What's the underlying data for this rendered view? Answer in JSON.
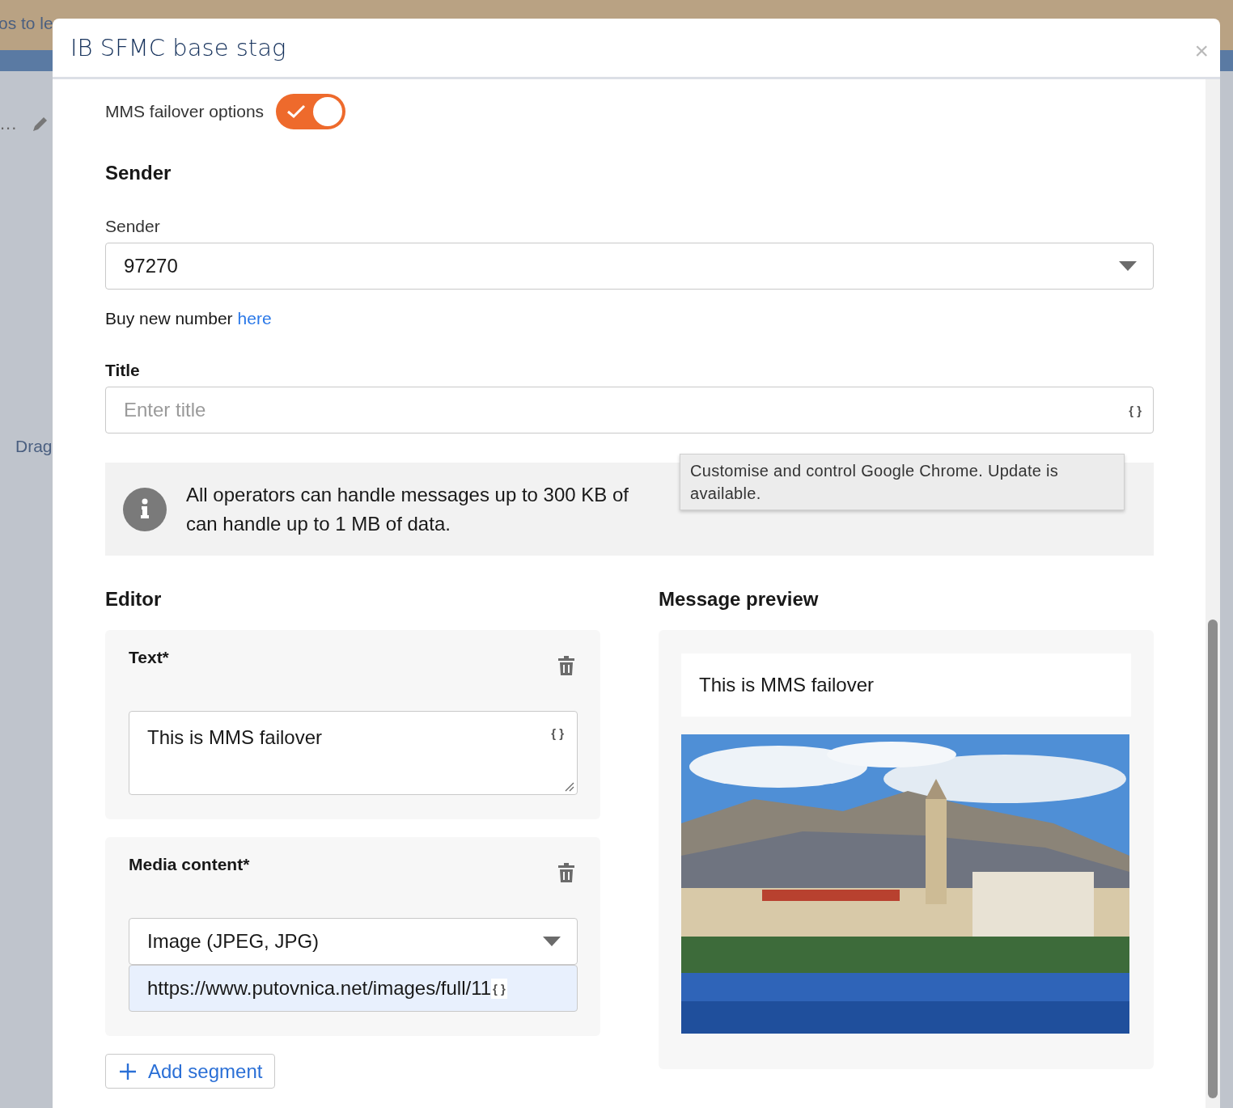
{
  "background": {
    "banner_text": "os to le",
    "side_text": "Drag",
    "menu_text": "..."
  },
  "dialog": {
    "title": "IB SFMC base stag",
    "close": "×"
  },
  "mms_failover": {
    "label": "MMS failover options",
    "on": true
  },
  "sender_section": {
    "heading": "Sender",
    "field_label": "Sender",
    "value": "97270",
    "buy_text": "Buy new number",
    "buy_link": "here"
  },
  "title_field": {
    "label": "Title",
    "placeholder": "Enter title",
    "variable_button": "{ }"
  },
  "info": {
    "lines": [
      "All operators can handle messages up to 300 KB of",
      "can handle up to 1 MB of data."
    ]
  },
  "tooltip": {
    "text": "Customise and control Google Chrome. Update is available."
  },
  "editor": {
    "heading": "Editor",
    "segments": [
      {
        "kind": "text",
        "label": "Text*",
        "value": "This is MMS failover",
        "variable_button": "{ }"
      },
      {
        "kind": "media",
        "label": "Media content*",
        "media_type": "Image (JPEG, JPG)",
        "url": "https://www.putovnica.net/images/full/11",
        "variable_button": "{ }"
      }
    ],
    "add_button": "Add segment"
  },
  "preview": {
    "heading": "Message preview",
    "text": "This is MMS failover"
  }
}
